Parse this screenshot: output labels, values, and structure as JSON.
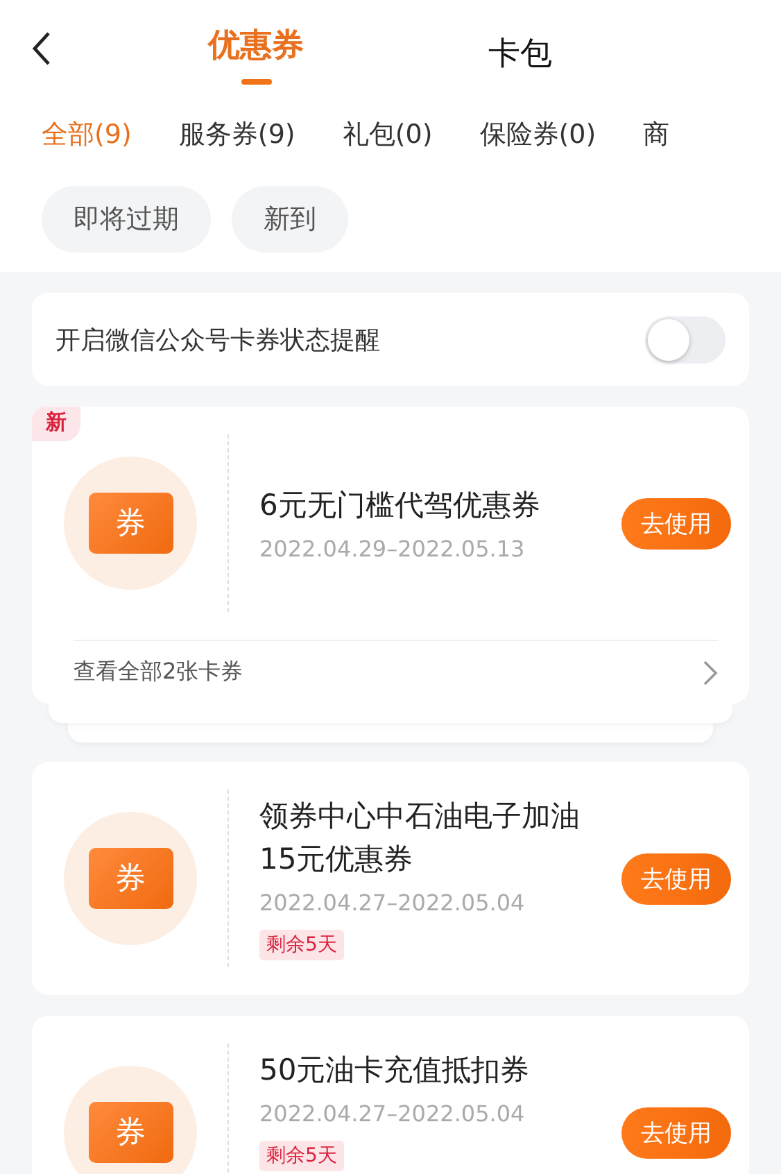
{
  "header": {
    "tabs": [
      {
        "label": "优惠券",
        "selected": true
      },
      {
        "label": "卡包",
        "selected": false
      }
    ]
  },
  "categories": [
    {
      "label": "全部(9)",
      "selected": true
    },
    {
      "label": "服务券(9)",
      "selected": false
    },
    {
      "label": "礼包(0)",
      "selected": false
    },
    {
      "label": "保险券(0)",
      "selected": false
    },
    {
      "label": "商",
      "selected": false
    }
  ],
  "filters": [
    {
      "label": "即将过期",
      "selected": false
    },
    {
      "label": "新到",
      "selected": false
    }
  ],
  "notice": {
    "label": "开启微信公众号卡券状态提醒",
    "on": false
  },
  "coupons": [
    {
      "kind": "group",
      "corner_label": "新",
      "icon_label": "券",
      "title": "6元无门槛代驾优惠券",
      "dates": "2022.04.29–2022.05.13",
      "button": "去使用",
      "footer": "查看全部2张卡券"
    },
    {
      "kind": "single",
      "icon_label": "券",
      "title": "领券中心中石油电子加油15元优惠券",
      "dates": "2022.04.27–2022.05.04",
      "tag": "剩余5天",
      "button": "去使用"
    },
    {
      "kind": "single",
      "icon_label": "券",
      "title": "50元油卡充值抵扣券",
      "dates": "2022.04.27–2022.05.04",
      "tag": "剩余5天",
      "button": "去使用"
    }
  ]
}
